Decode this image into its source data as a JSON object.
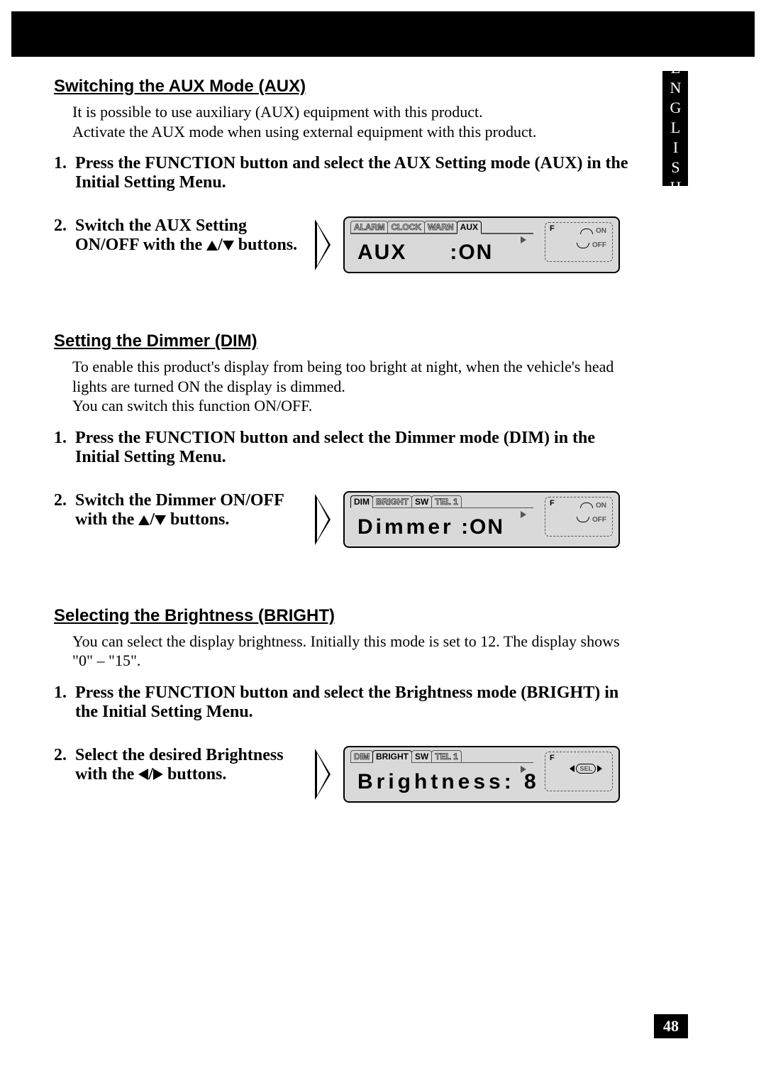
{
  "language_tab": "ENGLISH",
  "page_number": "48",
  "sections": {
    "aux": {
      "title": "Switching the AUX Mode (AUX)",
      "body_l1": "It is possible to use auxiliary (AUX) equipment with this product.",
      "body_l2": "Activate the AUX mode when using external equipment with this product.",
      "step1_num": "1.",
      "step1": "Press the FUNCTION button and select the AUX Setting mode (AUX) in the Initial Setting Menu.",
      "step2_num": "2.",
      "step2_a": "Switch the AUX Setting ON/OFF with the ",
      "step2_b": " buttons.",
      "lcd": {
        "tabs": {
          "t1": "ALARM",
          "t2": "CLOCK",
          "t3": "WARN",
          "t4": "AUX"
        },
        "main_label": "AUX",
        "main_value": ":ON",
        "panel": {
          "f": "F",
          "on": "ON",
          "off": "OFF"
        }
      }
    },
    "dim": {
      "title": "Setting the Dimmer (DIM)",
      "body_l1": "To enable this product's display from being too bright at night, when the vehicle's head lights are turned ON the display is dimmed.",
      "body_l2": "You can switch this function ON/OFF.",
      "step1_num": "1.",
      "step1": "Press the FUNCTION button and select the Dimmer mode (DIM) in the Initial Setting Menu.",
      "step2_num": "2.",
      "step2_a": "Switch the Dimmer ON/OFF with the ",
      "step2_b": " buttons.",
      "lcd": {
        "tabs": {
          "t1": "DIM",
          "t2": "BRIGHT",
          "t3": "SW",
          "t4": "TEL 1"
        },
        "main_label": "Dimmer",
        "main_value": ":ON",
        "panel": {
          "f": "F",
          "on": "ON",
          "off": "OFF"
        }
      }
    },
    "bright": {
      "title": "Selecting the Brightness (BRIGHT)",
      "body_l1": "You can select the display brightness. Initially this mode is set to 12. The display shows \"0\" – \"15\".",
      "step1_num": "1.",
      "step1": "Press the FUNCTION button and select the Brightness mode (BRIGHT) in the Initial Setting Menu.",
      "step2_num": "2.",
      "step2_a": "Select the desired Brightness with the ",
      "step2_b": " buttons.",
      "lcd": {
        "tabs": {
          "t1": "DIM",
          "t2": "BRIGHT",
          "t3": "SW",
          "t4": "TEL 1"
        },
        "main_label": "Brightness:",
        "main_value": "8",
        "panel": {
          "f": "F",
          "sel": "SEL"
        }
      }
    }
  }
}
